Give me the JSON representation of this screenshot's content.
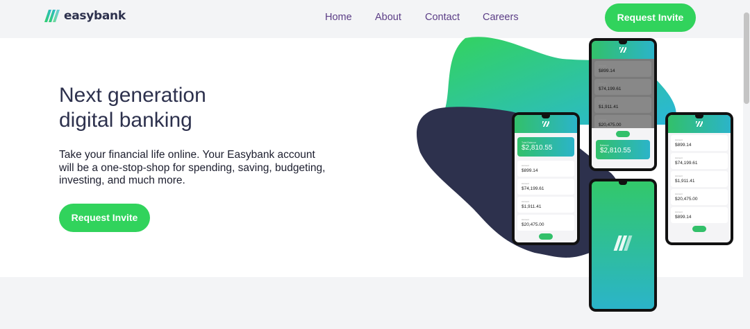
{
  "header": {
    "logo_text": "easybank",
    "nav": [
      "Home",
      "About",
      "Contact",
      "Careers"
    ],
    "cta_label": "Request Invite"
  },
  "hero": {
    "title_line1": "Next generation",
    "title_line2": "digital banking",
    "body": "Take your financial life online. Your Easybank account will be a one-stop-shop for spending, saving, budgeting, investing, and much more.",
    "cta_label": "Request Invite"
  },
  "phones": {
    "balance": "$2,810.55",
    "rows": [
      "$899.14",
      "$74,199.61",
      "$1,911.41",
      "$20,475.00",
      "$899.14"
    ]
  },
  "colors": {
    "accent_green": "#31d35c",
    "accent_cyan": "#2bb4c9",
    "navy": "#2d314d"
  }
}
